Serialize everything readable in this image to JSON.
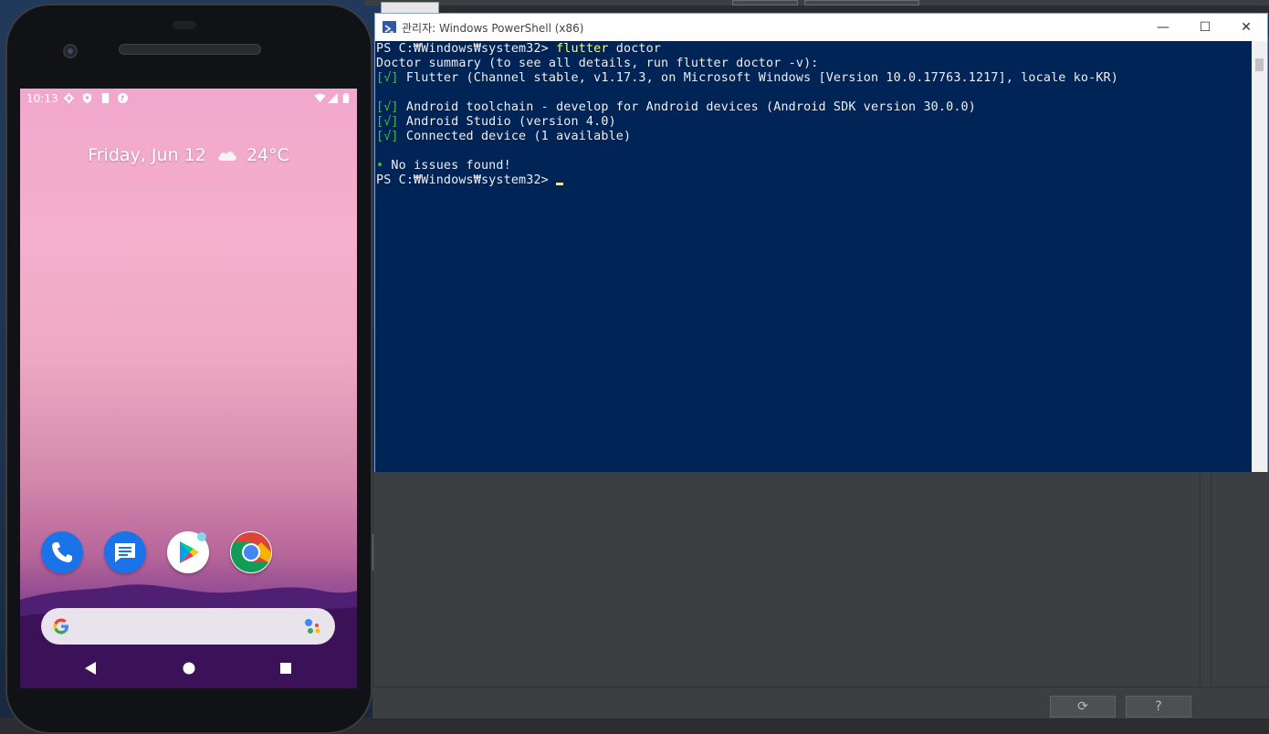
{
  "powershell": {
    "title": "관리자: Windows PowerShell (x86)",
    "controls": {
      "minimize": "—",
      "maximize": "☐",
      "close": "✕"
    },
    "prompt": "PS C:₩Windows₩system32> ",
    "command_keyword": "flutter",
    "command_rest": " doctor",
    "summary": "Doctor summary (to see all details, run flutter doctor -v):",
    "checks": [
      {
        "mark": "[√]",
        "text": " Flutter (Channel stable, v1.17.3, on Microsoft Windows [Version 10.0.17763.1217], locale ko-KR)"
      },
      {
        "mark": "[√]",
        "text": " Android toolchain - develop for Android devices (Android SDK version 30.0.0)"
      },
      {
        "mark": "[√]",
        "text": " Android Studio (version 4.0)"
      },
      {
        "mark": "[√]",
        "text": " Connected device (1 available)"
      }
    ],
    "bullet": "•",
    "result": " No issues found!",
    "prompt2": "PS C:₩Windows₩system32> "
  },
  "phone": {
    "status_time": "10:13",
    "date_text": "Friday, Jun 12",
    "weather_text": "24°C",
    "dock_apps": [
      "phone-app",
      "messages-app",
      "play-store-app",
      "chrome-app"
    ],
    "nav": [
      "back",
      "home",
      "recents"
    ]
  },
  "ide": {
    "refresh_glyph": "⟳",
    "help_label": "?"
  },
  "colors": {
    "ps_background": "#012456",
    "ps_keyword": "#ffff60",
    "ps_check": "#3fc13f"
  }
}
